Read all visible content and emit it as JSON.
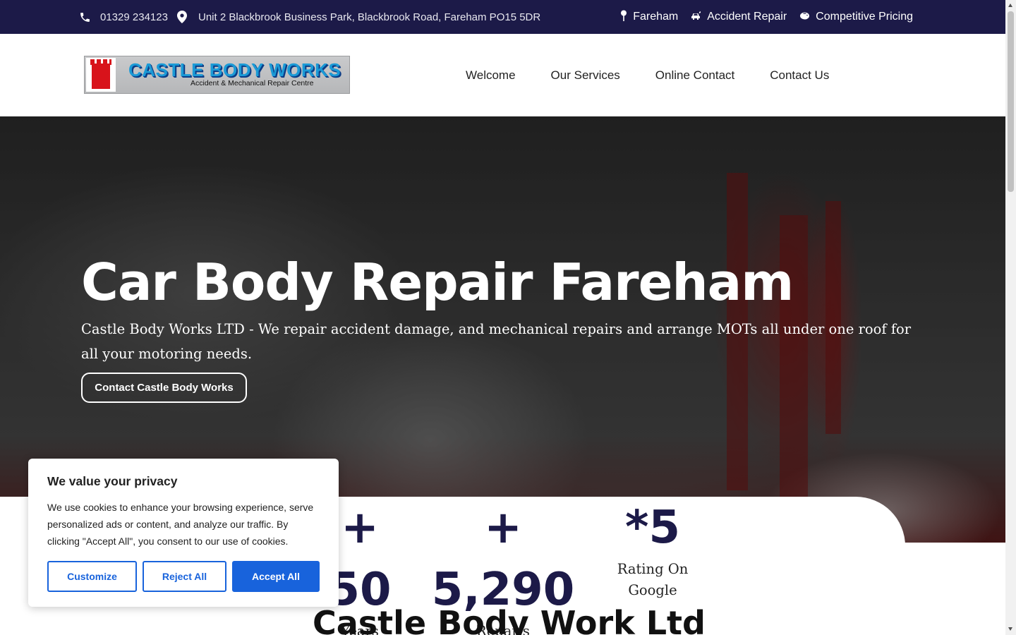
{
  "topbar": {
    "phone": "01329 234123",
    "address": "Unit 2 Blackbrook Business Park, Blackbrook Road, Fareham PO15 5DR",
    "right_items": [
      {
        "icon": "map-pin-icon",
        "label": "Fareham"
      },
      {
        "icon": "car-crash-icon",
        "label": "Accident Repair"
      },
      {
        "icon": "piggy-bank-icon",
        "label": "Competitive Pricing"
      }
    ]
  },
  "header": {
    "logo": {
      "name": "CASTLE BODY WORKS",
      "tagline": "Accident & Mechanical Repair Centre"
    },
    "nav": [
      "Welcome",
      "Our Services",
      "Online Contact",
      "Contact Us"
    ]
  },
  "hero": {
    "title": "Car Body Repair Fareham",
    "subtitle": "Castle Body Works LTD - We repair accident damage, and mechanical repairs and arrange MOTs all under one roof for all your motoring needs.",
    "cta": "Contact Castle Body Works"
  },
  "stats": [
    {
      "number": "+ 50",
      "label": "Years Experience"
    },
    {
      "number": "+ 5,290",
      "label": "Repairs"
    },
    {
      "number": "*5",
      "label": "Rating On Google"
    }
  ],
  "section_title": "Castle Body Work Ltd",
  "cookie": {
    "title": "We value your privacy",
    "body": "We use cookies to enhance your browsing experience, serve personalized ads or content, and analyze our traffic. By clicking \"Accept All\", you consent to our use of cookies.",
    "customize": "Customize",
    "reject": "Reject All",
    "accept": "Accept All"
  },
  "colors": {
    "topbar": "#1c1a48",
    "accent": "#1863dc",
    "stat_number": "#1c1a48"
  }
}
